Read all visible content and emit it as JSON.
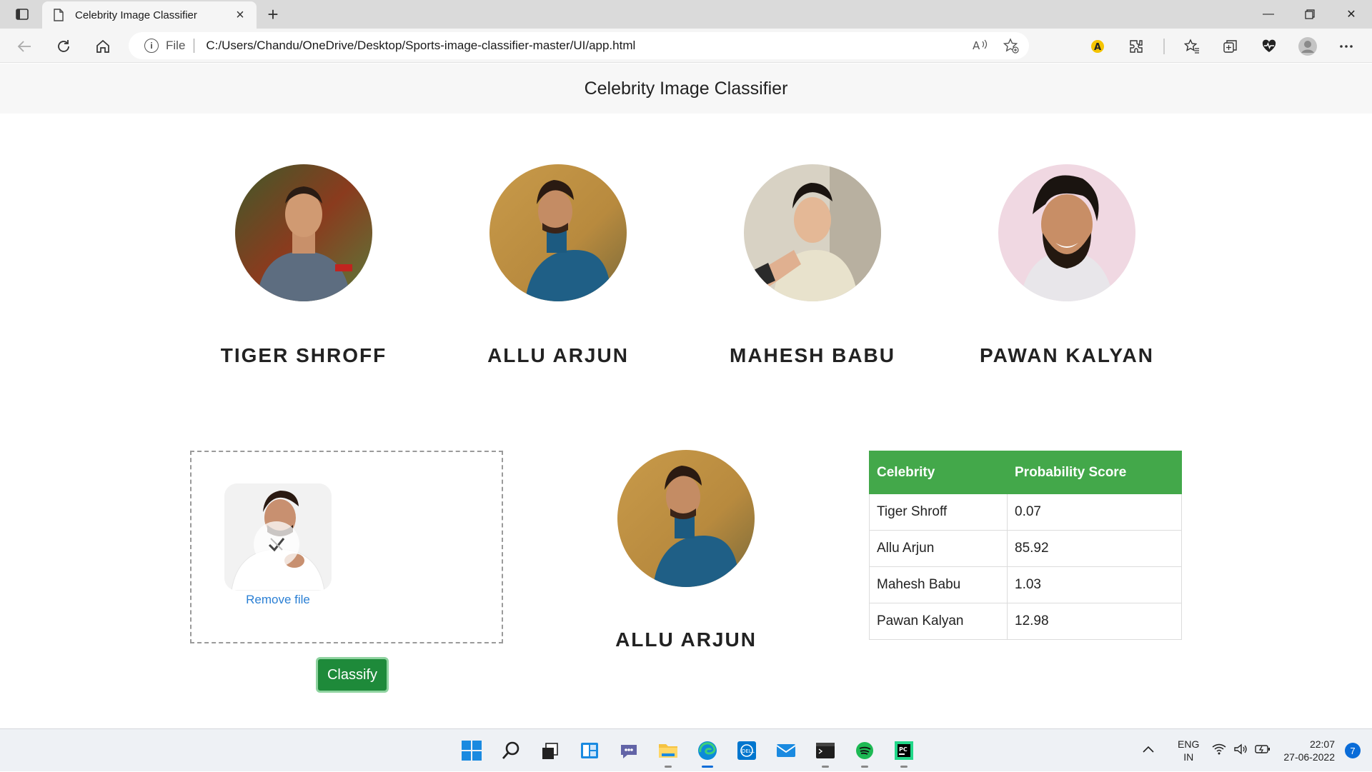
{
  "browser": {
    "tab_title": "Celebrity Image Classifier",
    "scheme_label": "File",
    "url": "C:/Users/Chandu/OneDrive/Desktop/Sports-image-classifier-master/UI/app.html"
  },
  "header": {
    "title": "Celebrity Image Classifier"
  },
  "celebrities": [
    {
      "name": "TIGER SHROFF"
    },
    {
      "name": "ALLU ARJUN"
    },
    {
      "name": "MAHESH BABU"
    },
    {
      "name": "PAWAN KALYAN"
    }
  ],
  "upload": {
    "remove_label": "Remove file",
    "button_label": "Classify"
  },
  "result": {
    "name": "ALLU ARJUN"
  },
  "score_table": {
    "headers": [
      "Celebrity",
      "Probability Score"
    ],
    "rows": [
      {
        "celebrity": "Tiger Shroff",
        "score": "0.07"
      },
      {
        "celebrity": "Allu Arjun",
        "score": "85.92"
      },
      {
        "celebrity": "Mahesh Babu",
        "score": "1.03"
      },
      {
        "celebrity": "Pawan Kalyan",
        "score": "12.98"
      }
    ]
  },
  "taskbar": {
    "lang_line1": "ENG",
    "lang_line2": "IN",
    "time": "22:07",
    "date": "27-06-2022",
    "notification_count": "7"
  },
  "colors": {
    "accent_green": "#43a84a",
    "button_green": "#1e8a3a",
    "link_blue": "#2a7fd4"
  }
}
